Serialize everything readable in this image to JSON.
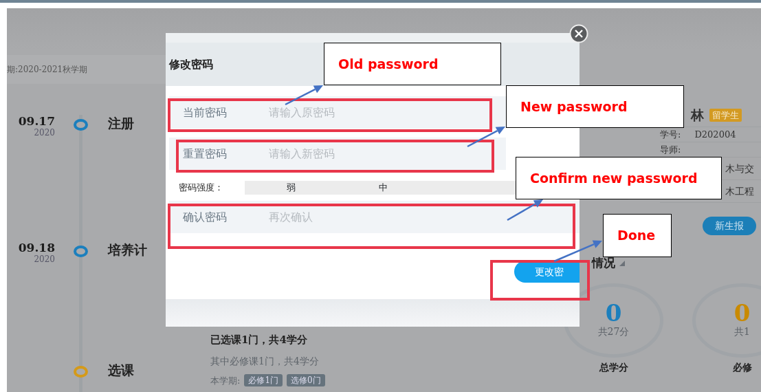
{
  "page": {
    "term": "期:2020-2021秋学期",
    "timeline": [
      {
        "date": "09.17",
        "year": "2020",
        "title": "注册",
        "color": "#1b7fbd"
      },
      {
        "date": "09.18",
        "year": "2020",
        "title": "培养计",
        "color": "#1b7fbd"
      },
      {
        "title": "选课",
        "color": "#d49a1a"
      }
    ],
    "course_summary": {
      "headline": "已选课1门，共4学分",
      "detail": "其中必修课1门，共4学分",
      "term_label": "本学期:",
      "tags": [
        "必修1门",
        "选修0门"
      ]
    },
    "profile": {
      "name": "林",
      "tag": "留学生",
      "fields": [
        {
          "label": "学号:",
          "value": "D202004"
        },
        {
          "label": "导师:"
        }
      ],
      "lines": [
        "木与交",
        "木工程"
      ],
      "button": "新生报"
    },
    "credits": {
      "title": "情况",
      "stats": [
        {
          "value": "0",
          "total": "共27分",
          "label": "总学分",
          "color": "#1b7fbd"
        },
        {
          "value": "0",
          "total": "共1",
          "label": "必修",
          "color": "#c98a00"
        }
      ]
    }
  },
  "dialog": {
    "title": "修改密码",
    "items": [
      {
        "kind": "field",
        "label": "当前密码",
        "placeholder": "请输入原密码"
      },
      {
        "kind": "field",
        "label": "重置密码",
        "placeholder": "请输入新密码"
      },
      {
        "kind": "strength",
        "label": "密码强度：",
        "levels": [
          "弱",
          "中"
        ]
      },
      {
        "kind": "field",
        "label": "确认密码",
        "placeholder": "再次确认"
      }
    ],
    "button": "更改密"
  },
  "annotations": [
    {
      "text": "Old password"
    },
    {
      "text": "New password"
    },
    {
      "text": "Confirm new password"
    },
    {
      "text": "Done"
    }
  ]
}
